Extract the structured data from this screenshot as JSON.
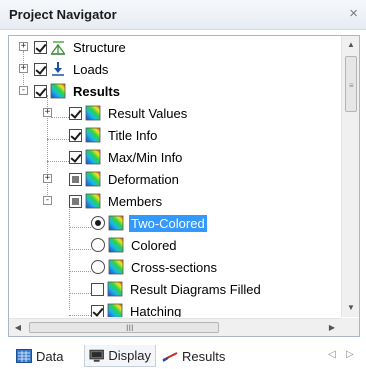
{
  "panel": {
    "title": "Project Navigator",
    "close_glyph": "×"
  },
  "tree": {
    "items": [
      {
        "label": "Structure",
        "control": "checkbox",
        "state": "checked",
        "expander": "+",
        "icon": "structure-icon",
        "level": 0
      },
      {
        "label": "Loads",
        "control": "checkbox",
        "state": "checked",
        "expander": "+",
        "icon": "loads-icon",
        "level": 0
      },
      {
        "label": "Results",
        "control": "checkbox",
        "state": "checked",
        "expander": "-",
        "icon": "results-icon",
        "level": 0,
        "bold": true
      },
      {
        "label": "Result Values",
        "control": "checkbox",
        "state": "checked",
        "expander": "+",
        "icon": "result-gradient-icon",
        "level": 1
      },
      {
        "label": "Title Info",
        "control": "checkbox",
        "state": "checked",
        "icon": "result-gradient-icon",
        "level": 1
      },
      {
        "label": "Max/Min Info",
        "control": "checkbox",
        "state": "checked",
        "icon": "result-gradient-icon",
        "level": 1
      },
      {
        "label": "Deformation",
        "control": "checkbox",
        "state": "partial",
        "expander": "+",
        "icon": "result-gradient-icon",
        "level": 1
      },
      {
        "label": "Members",
        "control": "checkbox",
        "state": "partial",
        "expander": "-",
        "icon": "result-gradient-icon",
        "level": 1
      },
      {
        "label": "Two-Colored",
        "control": "radio",
        "state": "selected",
        "icon": "result-gradient-icon",
        "level": 2,
        "highlighted": true
      },
      {
        "label": "Colored",
        "control": "radio",
        "state": "unselected",
        "icon": "result-gradient-icon",
        "level": 2
      },
      {
        "label": "Cross-sections",
        "control": "radio",
        "state": "unselected",
        "icon": "result-gradient-icon",
        "level": 2
      },
      {
        "label": "Result Diagrams Filled",
        "control": "checkbox",
        "state": "unchecked",
        "icon": "result-gradient-icon",
        "level": 2
      },
      {
        "label": "Hatching",
        "control": "checkbox",
        "state": "checked",
        "icon": "result-gradient-icon",
        "level": 2
      }
    ]
  },
  "scrollbars": {
    "vertical_grip": "≡",
    "horizontal_grip": "III"
  },
  "tabs": [
    {
      "label": "Data",
      "icon": "data-tab-icon",
      "active": false
    },
    {
      "label": "Display",
      "icon": "display-tab-icon",
      "active": true
    },
    {
      "label": "Results",
      "icon": "results-tab-icon",
      "active": false
    }
  ],
  "colors": {
    "selection": "#3399ff",
    "titlebar": "#e7ecf3",
    "border": "#a9b6c6"
  }
}
